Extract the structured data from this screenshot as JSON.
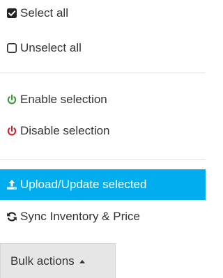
{
  "menu": {
    "items": [
      {
        "label": "Select all",
        "icon": "checked-checkbox-icon"
      },
      {
        "label": "Unselect all",
        "icon": "empty-checkbox-icon"
      },
      {
        "label": "Enable selection",
        "icon": "power-icon",
        "icon_color": "#3c9a34"
      },
      {
        "label": "Disable selection",
        "icon": "power-icon",
        "icon_color": "#c4252c"
      },
      {
        "label": "Upload/Update selected",
        "icon": "upload-icon",
        "active": true,
        "highlight_color": "#00aef0"
      },
      {
        "label": "Sync Inventory & Price",
        "icon": "sync-icon"
      }
    ]
  },
  "bulk_actions": {
    "label": "Bulk actions",
    "icon": "caret-up-icon"
  }
}
